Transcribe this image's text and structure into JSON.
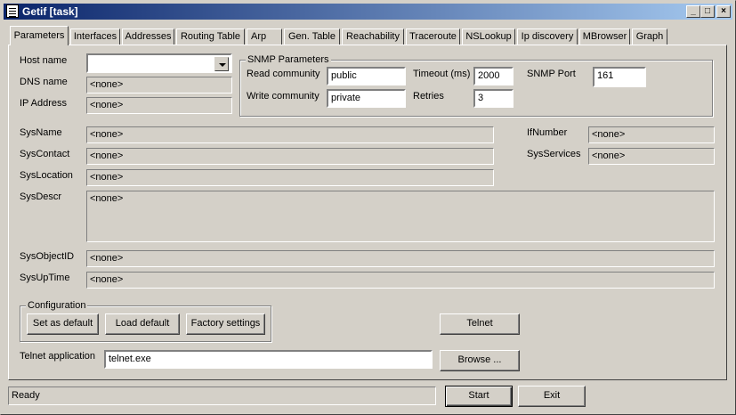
{
  "window": {
    "title": "Getif [task]",
    "controls": [
      "_",
      "□",
      "×"
    ]
  },
  "tabs": [
    "Parameters",
    "Interfaces",
    "Addresses",
    "Routing Table",
    "Arp",
    "Gen. Table",
    "Reachability",
    "Traceroute",
    "NSLookup",
    "Ip discovery",
    "MBrowser",
    "Graph"
  ],
  "host": {
    "host_name_label": "Host name",
    "host_name_value": "",
    "dns_label": "DNS name",
    "dns_value": "<none>",
    "ip_label": "IP Address",
    "ip_value": "<none>"
  },
  "snmp": {
    "group_title": "SNMP Parameters",
    "read_label": "Read community",
    "read_value": "public",
    "write_label": "Write community",
    "write_value": "private",
    "timeout_label": "Timeout (ms)",
    "timeout_value": "2000",
    "retries_label": "Retries",
    "retries_value": "3",
    "port_label": "SNMP Port",
    "port_value": "161"
  },
  "system": {
    "sysname_label": "SysName",
    "sysname_value": "<none>",
    "syscontact_label": "SysContact",
    "syscontact_value": "<none>",
    "syslocation_label": "SysLocation",
    "syslocation_value": "<none>",
    "sysdescr_label": "SysDescr",
    "sysdescr_value": "<none>",
    "ifnumber_label": "IfNumber",
    "ifnumber_value": "<none>",
    "sysservices_label": "SysServices",
    "sysservices_value": "<none>",
    "sysobjectid_label": "SysObjectID",
    "sysobjectid_value": "<none>",
    "sysuptime_label": "SysUpTime",
    "sysuptime_value": "<none>"
  },
  "config": {
    "group_title": "Configuration",
    "set_default": "Set as default",
    "load_default": "Load default",
    "factory": "Factory settings"
  },
  "telnet": {
    "button": "Telnet",
    "app_label": "Telnet application",
    "app_value": "telnet.exe",
    "browse": "Browse ..."
  },
  "footer": {
    "status": "Ready",
    "start": "Start",
    "exit": "Exit"
  }
}
